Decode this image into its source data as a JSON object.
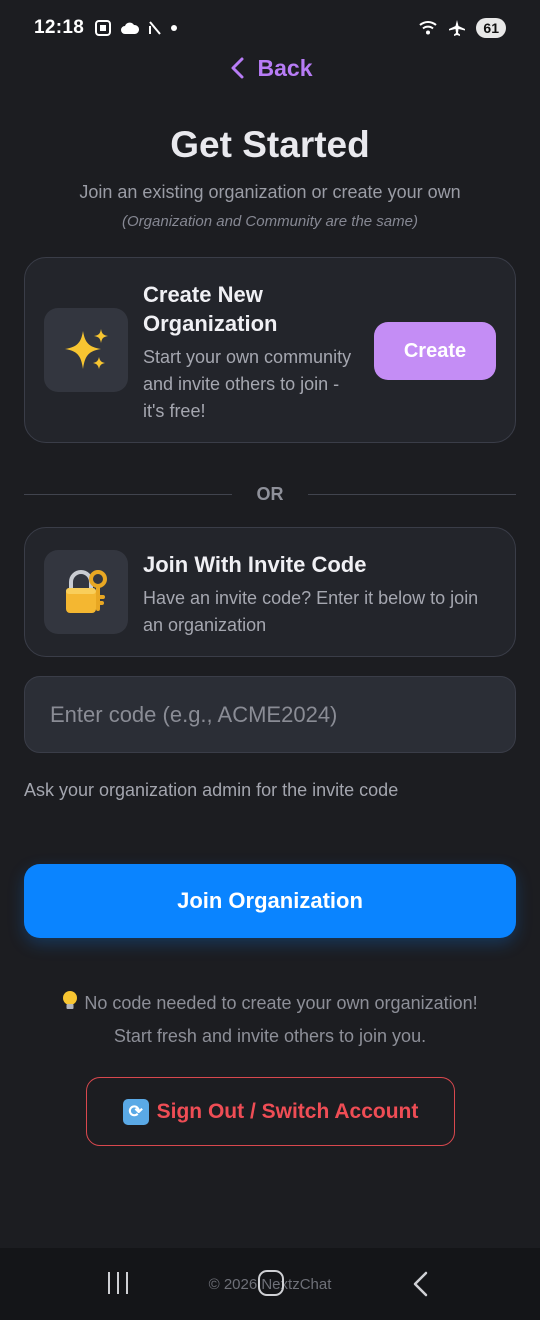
{
  "status_bar": {
    "time": "12:18",
    "battery": "61",
    "icons_left": [
      "screenshot-icon",
      "cloud-icon",
      "signal-slash-icon",
      "dot-icon"
    ],
    "icons_right": [
      "wifi-icon",
      "airplane-icon"
    ]
  },
  "header": {
    "back_label": "Back",
    "title": "Get Started",
    "subtitle": "Join an existing organization or create your own",
    "note": "(Organization and Community are the same)"
  },
  "create_card": {
    "icon": "sparkles-icon",
    "title": "Create New Organization",
    "description": "Start your own community and invite others to join - it's free!",
    "button_label": "Create"
  },
  "divider_label": "OR",
  "join_card": {
    "icon": "lock-key-icon",
    "title": "Join With Invite Code",
    "description": "Have an invite code? Enter it below to join an organization"
  },
  "code_input": {
    "placeholder": "Enter code (e.g., ACME2024)",
    "value": ""
  },
  "hint": "Ask your organization admin for the invite code",
  "join_button_label": "Join Organization",
  "tip": {
    "icon": "lightbulb-icon",
    "line1": "No code needed to create your own organization!",
    "line2": "Start fresh and invite others to join you."
  },
  "signout": {
    "icon": "refresh-icon",
    "label": "Sign Out / Switch Account"
  },
  "footer": {
    "copyright": "© 2026 NextzChat"
  },
  "colors": {
    "background": "#1c1d21",
    "accent_purple": "#b77cf5",
    "create_button": "#c48df5",
    "join_button": "#0a84ff",
    "signout_red": "#ef4d55"
  }
}
